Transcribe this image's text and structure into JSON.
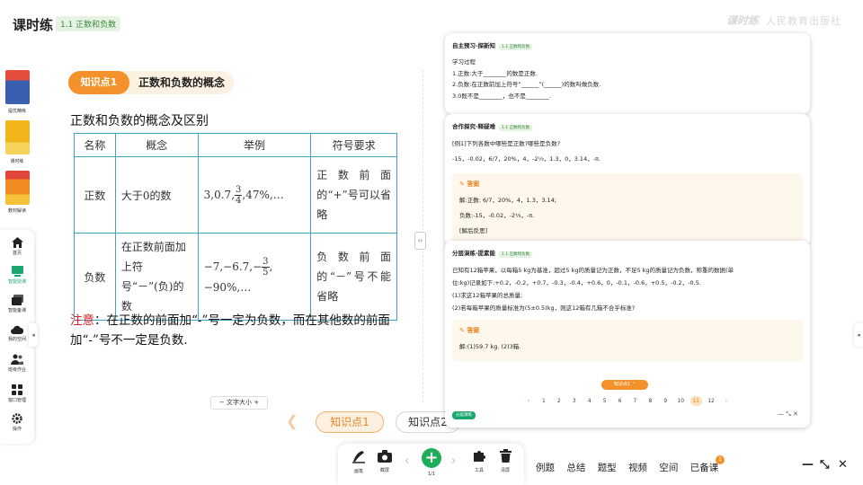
{
  "header": {
    "title": "课时练",
    "chip": "1.1 正数和负数",
    "brand": "课时练",
    "publisher": "人民教育出版社"
  },
  "left_rail": {
    "books": [
      {
        "label": "提优精练",
        "color": "#3a5fb0"
      },
      {
        "label": "课时练",
        "color": "#f2b61a"
      },
      {
        "label": "教材解读",
        "color": "#f08c22"
      }
    ],
    "nav": [
      {
        "label": "首页",
        "icon": "home-icon"
      },
      {
        "label": "智能授课",
        "icon": "screen-icon",
        "active": true
      },
      {
        "label": "智能备课",
        "icon": "stack-icon"
      },
      {
        "label": "我的空间",
        "icon": "cloud-icon"
      },
      {
        "label": "班级作业",
        "icon": "people-icon"
      },
      {
        "label": "窗口管理",
        "icon": "grid-icon"
      },
      {
        "label": "操作",
        "icon": "gear-icon"
      }
    ]
  },
  "lesson": {
    "pill": "知识点1",
    "title": "正数和负数的概念",
    "section": "正数和负数的概念及区别",
    "table": {
      "headers": [
        "名称",
        "概念",
        "举例",
        "符号要求"
      ],
      "rows": [
        {
          "name": "正数",
          "concept": "大于0的数",
          "ex_a": "3,0.7,",
          "frac_num": "3",
          "frac_den": "4",
          "ex_b": ",47%,…",
          "rule": "正数前面的“+”号可以省略"
        },
        {
          "name": "负数",
          "concept": "在正数前面加上符号“－”(负)的数",
          "ex_a": "−7,−6.7,−",
          "frac_num": "3",
          "frac_den": "5",
          "ex_b": ",−90%,…",
          "rule": "负数前面的“－”号不能省略"
        }
      ]
    },
    "note_label": "注意",
    "note_text": "：在正数的前面加“-”号一定为负数，而在其他数的前面加“-”号不一定是负数.",
    "font_size_label": "文字大小",
    "nav_active": "知识点1",
    "nav_next": "知识点2"
  },
  "card1": {
    "header": "自主预习·探新知",
    "chip": "1.1 正数和负数",
    "lines": [
      "学习过程",
      "1.正数:大于________的数是正数.",
      "2.负数:在正数前加上符号“______”(______)的数叫做负数.",
      "3.0既不是________，也不是________."
    ]
  },
  "card2": {
    "header": "合作探究·释疑难",
    "chip": "1.1 正数和负数",
    "question": "[例1]下列各数中哪些是正数?哪些是负数?",
    "numbers": "-15，-0.02，6/7，20%，4，-2⅓，1.3，0，3.14，-π.",
    "answer_title": "答案",
    "answers": [
      "解:正数: 6/7，20%，4，1.3，3.14;",
      "负数:-15，-0.02，-2⅓，-π.",
      "[解后反思]"
    ]
  },
  "card3": {
    "header": "分层演练·提素能",
    "chip": "1.1 正数和负数",
    "lines": [
      "已知有12箱苹果，以每箱5 kg为基准，超过5 kg的质量记为正数，不足5 kg的质量记为负数，称重的数据(单",
      "位:kg)记录如下:+0.2，-0.2，+0.7，-0.3，-0.4，+0.6，0，-0.1，-0.6，+0.5，-0.2，-0.5.",
      "(1)求这12箱苹果的总质量;",
      "(2)若每箱苹果的质量标准为(5±0.5)kg，则这12箱有几箱不合乎标准?"
    ],
    "answer_title": "答案",
    "answer": "解:(1)59.7 kg.   (2)3箱.",
    "action_label": "知识点1",
    "pages": [
      "1",
      "2",
      "3",
      "4",
      "5",
      "6",
      "7",
      "8",
      "9",
      "10",
      "11",
      "12"
    ],
    "current_page": "11",
    "tag": "分层演练"
  },
  "toolbar": {
    "pen": "画笔",
    "screenshot": "截屏",
    "page": "1/1",
    "tools": "工具",
    "clear": "清屏"
  },
  "right_menu": [
    "例题",
    "总结",
    "题型",
    "视频",
    "空间",
    "已备课"
  ],
  "badge_count": "1",
  "win": {
    "min": "—",
    "shrink": "⤡",
    "close": "✕"
  }
}
